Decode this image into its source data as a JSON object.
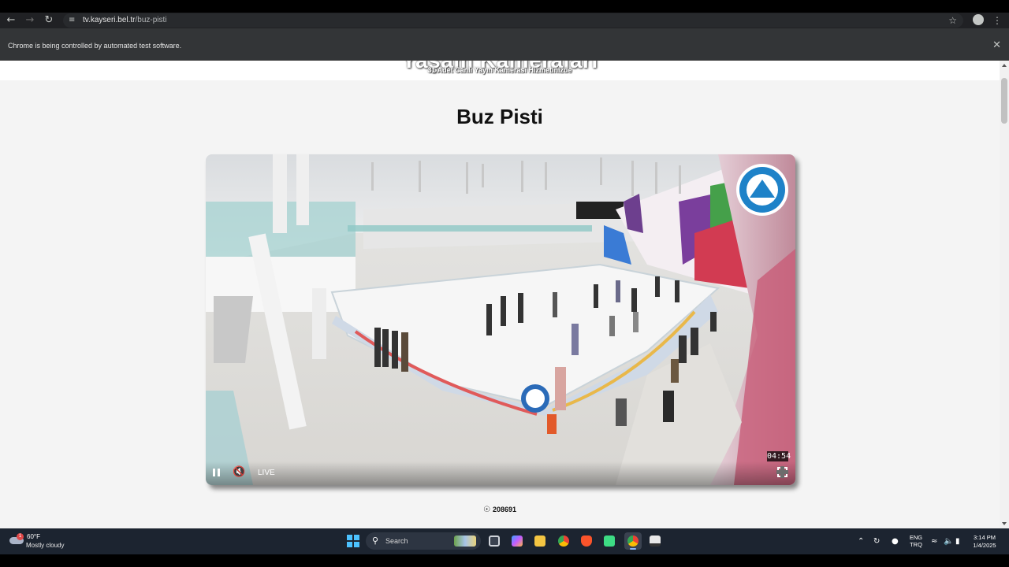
{
  "browser": {
    "url_host": "tv.kayseri.bel.tr",
    "url_path": "/buz-pisti",
    "infobar_text": "Chrome is being controlled by automated test software.",
    "icons": {
      "back": "back-arrow-icon",
      "forward": "forward-arrow-icon",
      "reload": "reload-icon",
      "site_info": "tune-icon",
      "bookmark": "star-icon",
      "profile": "profile-icon",
      "menu": "menu-dots-icon",
      "close": "close-icon"
    }
  },
  "page": {
    "header_title": "Yaşam Kameraları",
    "header_subtitle": "31 Adet Canlı Yayın Kamerası Hizmetinizde",
    "title": "Buz Pisti",
    "player": {
      "timer": "04:54",
      "live_label": "LIVE",
      "controls": [
        "pause-icon",
        "muted-speaker-icon",
        "fullscreen-icon"
      ]
    },
    "views": "208691",
    "views_icon": "eye-icon"
  },
  "taskbar": {
    "weather": {
      "temp": "60°F",
      "desc": "Mostly cloudy",
      "badge": "1"
    },
    "search_label": "Search",
    "apps": [
      "task-view-icon",
      "copilot-icon",
      "file-explorer-icon",
      "chrome-icon",
      "brave-icon",
      "android-studio-icon",
      "chrome-active-icon",
      "terminal-icon"
    ],
    "lang_line1": "ENG",
    "lang_line2": "TRQ",
    "time": "3:14 PM",
    "date": "1/4/2025"
  },
  "colors": {
    "chrome_bg": "#202124",
    "infobar_bg": "#333537",
    "page_bg": "#f4f4f4",
    "taskbar_bg": "#1c2430",
    "accent": "#4cc2ff"
  }
}
